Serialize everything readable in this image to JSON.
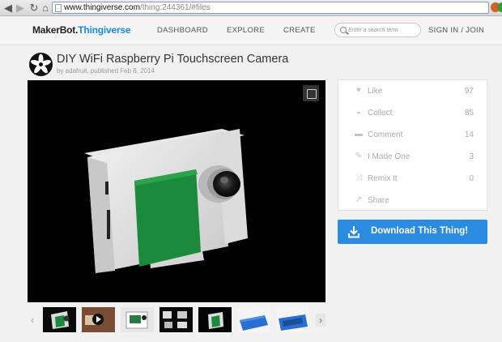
{
  "browser": {
    "url_host": "www.thingiverse.com",
    "url_path": "/thing:244361/#files"
  },
  "header": {
    "logo_maker": "MakerBot.",
    "logo_thing": "Thingiverse",
    "nav": [
      "DASHBOARD",
      "EXPLORE",
      "CREATE"
    ],
    "search_placeholder": "Enter a search term",
    "auth": "SIGN IN / JOIN"
  },
  "thing": {
    "title": "DIY WiFi Raspberry Pi Touchscreen Camera",
    "byline": "by adafruit, published Feb 8, 2014"
  },
  "stats": [
    {
      "label": "Like",
      "count": "97",
      "icon": "heart-icon"
    },
    {
      "label": "Collect",
      "count": "85",
      "icon": "collect-icon"
    },
    {
      "label": "Comment",
      "count": "14",
      "icon": "comment-icon"
    },
    {
      "label": "I Made One",
      "count": "3",
      "icon": "made-icon"
    },
    {
      "label": "Remix It",
      "count": "0",
      "icon": "remix-icon"
    },
    {
      "label": "Share",
      "count": "",
      "icon": "share-icon"
    }
  ],
  "download": {
    "label": "Download This Thing!"
  },
  "colors": {
    "accent": "#2a8be0",
    "brand": "#1f8ad8",
    "case_green": "#1b8a3c"
  }
}
